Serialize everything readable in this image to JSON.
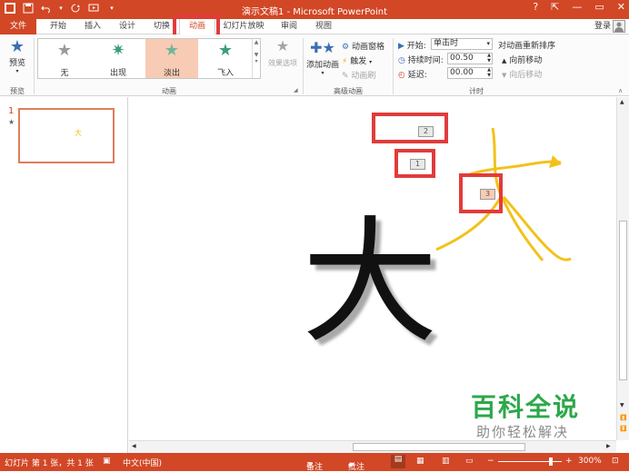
{
  "titlebar": {
    "title": "演示文稿1 - Microsoft PowerPoint",
    "help": "?",
    "min": "—",
    "restore": "▭",
    "close": "✕"
  },
  "tabs": {
    "file": "文件",
    "home": "开始",
    "insert": "插入",
    "design": "设计",
    "transitions": "切换",
    "animations": "动画",
    "slideshow": "幻灯片放映",
    "review": "审阅",
    "view": "视图"
  },
  "login": "登录",
  "ribbon": {
    "preview": {
      "label": "预览",
      "group": "预览"
    },
    "gallery": [
      {
        "label": "无"
      },
      {
        "label": "出现"
      },
      {
        "label": "淡出"
      },
      {
        "label": "飞入"
      }
    ],
    "effect_options": "效果选项",
    "animation_group": "动画",
    "add_animation": "添加动画",
    "animation_pane": "动画窗格",
    "trigger": "触发",
    "animation_painter": "动画刷",
    "advanced_group": "高级动画",
    "start_label": "开始:",
    "start_value": "单击时",
    "duration_label": "持续时间:",
    "duration_value": "00.50",
    "delay_label": "延迟:",
    "delay_value": "00.00",
    "reorder": "对动画重新排序",
    "move_earlier": "向前移动",
    "move_later": "向后移动",
    "timing_group": "计时"
  },
  "slides": {
    "number": "1",
    "star": "★",
    "thumb_char": "大"
  },
  "canvas": {
    "big_char": "大",
    "tags": [
      "2",
      "1",
      "3"
    ]
  },
  "watermark": {
    "line1": "百科全说",
    "line2": "助你轻松解决"
  },
  "statusbar": {
    "slide_info": "幻灯片 第 1 张，共 1 张",
    "language": "中文(中国)",
    "notes": "备注",
    "comments": "批注",
    "zoom": "300%"
  },
  "colors": {
    "accent": "#d24726",
    "selection": "#f8cbb4",
    "highlight": "#e23b3b",
    "path": "#f2c21b"
  }
}
